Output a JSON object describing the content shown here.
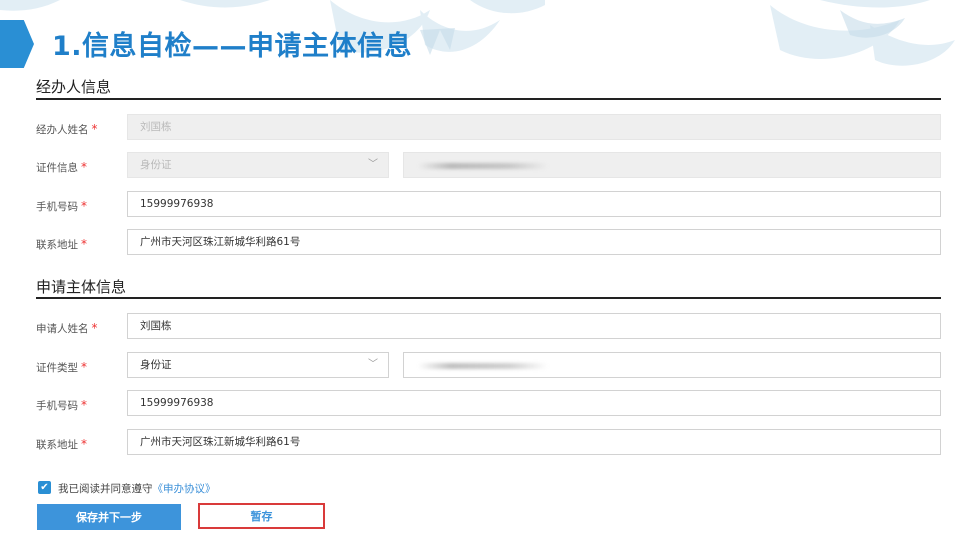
{
  "header": {
    "title": "1.信息自检——申请主体信息",
    "accent_color": "#2a8fd4"
  },
  "agent_section": {
    "title": "经办人信息",
    "fields": [
      {
        "label": "经办人姓名",
        "value": "刘国栋",
        "disabled": true
      },
      {
        "label": "证件信息",
        "select_value": "身份证",
        "disabled": true
      },
      {
        "label": "手机号码",
        "value": "15999976938"
      },
      {
        "label": "联系地址",
        "value": "广州市天河区珠江新城华利路61号"
      }
    ]
  },
  "applicant_section": {
    "title": "申请主体信息",
    "fields": [
      {
        "label": "申请人姓名",
        "value": "刘国栋"
      },
      {
        "label": "证件类型",
        "select_value": "身份证"
      },
      {
        "label": "手机号码",
        "value": "15999976938"
      },
      {
        "label": "联系地址",
        "value": "广州市天河区珠江新城华利路61号"
      }
    ]
  },
  "required_mark": "*",
  "agreement": {
    "text": "我已阅读并同意遵守",
    "link": "《申办协议》",
    "checked": true
  },
  "buttons": {
    "save_next": "保存并下一步",
    "temp_save": "暂存"
  },
  "icons": {
    "select_arrow": "chevron-down-icon",
    "checkbox": "check-icon"
  }
}
